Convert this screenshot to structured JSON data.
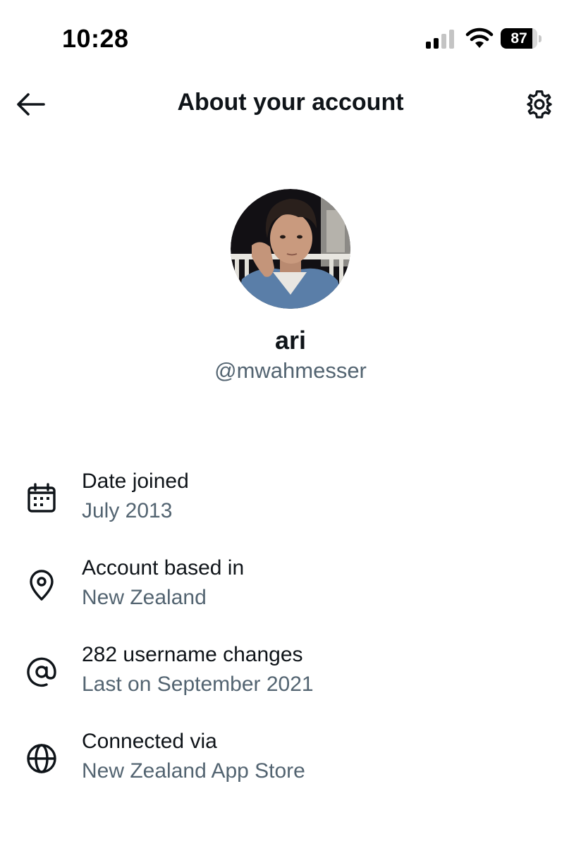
{
  "status_bar": {
    "time": "10:28",
    "battery_percent": "87",
    "battery_level": 0.87,
    "signal_bars_active": 2,
    "signal_bars_total": 4
  },
  "header": {
    "title": "About your account",
    "back_icon": "arrow-left-icon",
    "settings_icon": "gear-icon"
  },
  "profile": {
    "name": "ari",
    "handle": "@mwahmesser"
  },
  "info": {
    "items": [
      {
        "icon": "calendar-icon",
        "label": "Date joined",
        "value": "July 2013"
      },
      {
        "icon": "location-pin-icon",
        "label": "Account based in",
        "value": "New Zealand"
      },
      {
        "icon": "at-sign-icon",
        "label": "282 username changes",
        "value": "Last on September 2021"
      },
      {
        "icon": "globe-icon",
        "label": "Connected via",
        "value": "New Zealand App Store"
      }
    ]
  },
  "colors": {
    "primary_text": "#0f1419",
    "secondary_text": "#536471",
    "background": "#ffffff"
  }
}
